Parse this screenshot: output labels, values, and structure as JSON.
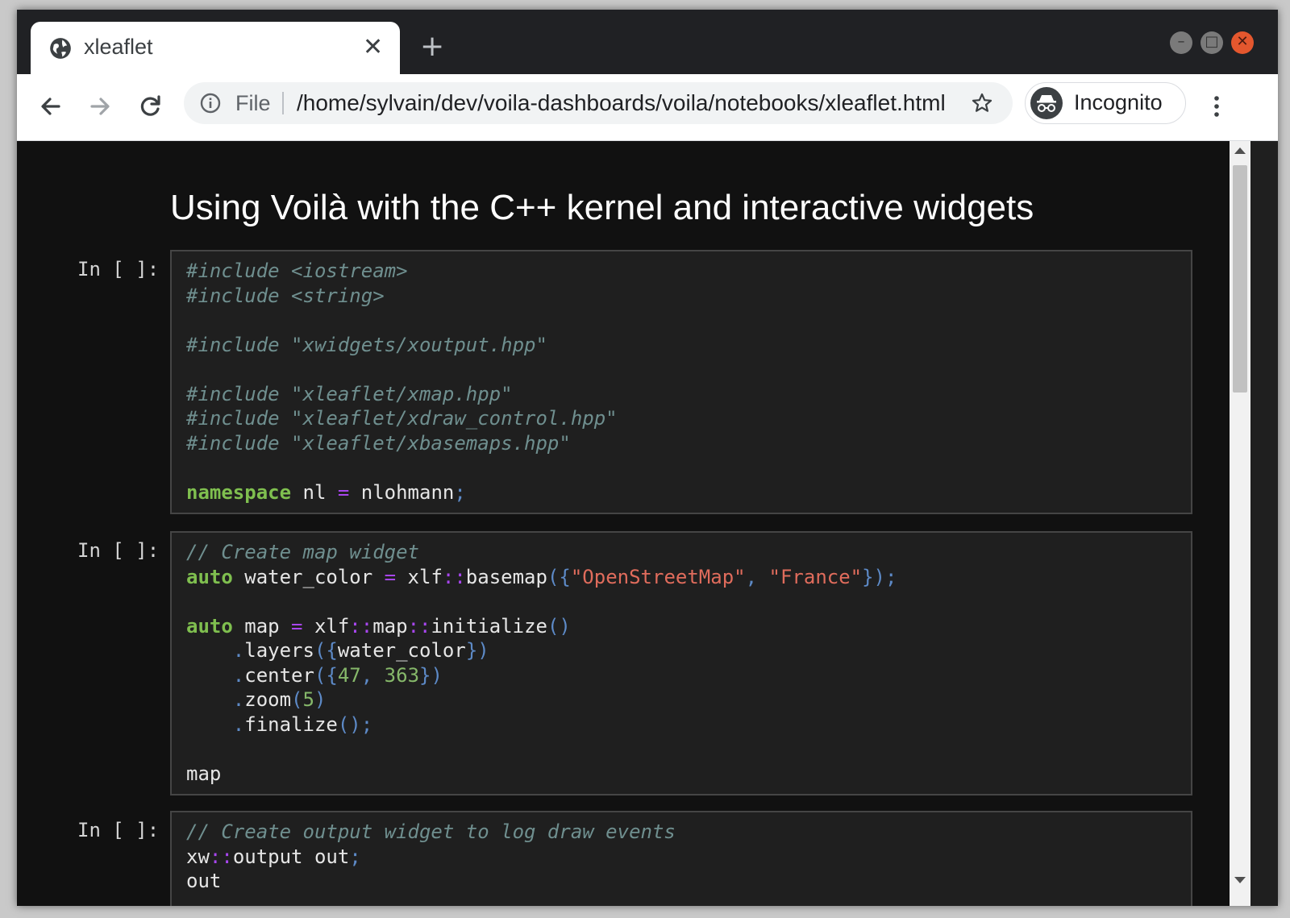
{
  "browser": {
    "tab": {
      "title": "xleaflet",
      "close_glyph": "✕",
      "icon": "globe-icon"
    },
    "new_tab_glyph": "+",
    "window_controls": {
      "minimize": "–",
      "maximize": "□",
      "close": "✕",
      "close_color": "#e4572e"
    },
    "omnibox": {
      "info_icon": "info-icon",
      "scheme_label": "File",
      "url": "/home/sylvain/dev/voila-dashboards/voila/notebooks/xleaflet.html",
      "bookmark_icon": "star-icon"
    },
    "incognito": {
      "label": "Incognito",
      "icon": "incognito-icon"
    },
    "nav": {
      "back_icon": "arrow-left-icon",
      "forward_icon": "arrow-right-icon",
      "reload_icon": "reload-icon",
      "menu_icon": "kebab-menu-icon"
    }
  },
  "page": {
    "title": "Using Voilà with the C++ kernel and interactive widgets",
    "cells": [
      {
        "prompt": "In [ ]:",
        "lines": [
          [
            [
              "cm",
              "#include <iostream>"
            ]
          ],
          [
            [
              "cm",
              "#include <string>"
            ]
          ],
          [],
          [
            [
              "cm",
              "#include \"xwidgets/xoutput.hpp\""
            ]
          ],
          [],
          [
            [
              "cm",
              "#include \"xleaflet/xmap.hpp\""
            ]
          ],
          [
            [
              "cm",
              "#include \"xleaflet/xdraw_control.hpp\""
            ]
          ],
          [
            [
              "cm",
              "#include \"xleaflet/xbasemaps.hpp\""
            ]
          ],
          [],
          [
            [
              "kw",
              "namespace"
            ],
            [
              "tx",
              " nl "
            ],
            [
              "op",
              "="
            ],
            [
              "tx",
              " nlohmann"
            ],
            [
              "pn",
              ";"
            ]
          ]
        ]
      },
      {
        "prompt": "In [ ]:",
        "lines": [
          [
            [
              "cm",
              "// Create map widget"
            ]
          ],
          [
            [
              "kw",
              "auto"
            ],
            [
              "tx",
              " water_color "
            ],
            [
              "op",
              "="
            ],
            [
              "tx",
              " xlf"
            ],
            [
              "op",
              "::"
            ],
            [
              "tx",
              "basemap"
            ],
            [
              "pn",
              "({"
            ],
            [
              "st",
              "\"OpenStreetMap\""
            ],
            [
              "pn",
              ", "
            ],
            [
              "st",
              "\"France\""
            ],
            [
              "pn",
              "});"
            ]
          ],
          [],
          [
            [
              "kw",
              "auto"
            ],
            [
              "tx",
              " map "
            ],
            [
              "op",
              "="
            ],
            [
              "tx",
              " xlf"
            ],
            [
              "op",
              "::"
            ],
            [
              "tx",
              "map"
            ],
            [
              "op",
              "::"
            ],
            [
              "tx",
              "initialize"
            ],
            [
              "pn",
              "()"
            ]
          ],
          [
            [
              "tx",
              "    "
            ],
            [
              "pn",
              "."
            ],
            [
              "tx",
              "layers"
            ],
            [
              "pn",
              "({"
            ],
            [
              "tx",
              "water_color"
            ],
            [
              "pn",
              "})"
            ]
          ],
          [
            [
              "tx",
              "    "
            ],
            [
              "pn",
              "."
            ],
            [
              "tx",
              "center"
            ],
            [
              "pn",
              "({"
            ],
            [
              "nm",
              "47"
            ],
            [
              "pn",
              ", "
            ],
            [
              "nm",
              "363"
            ],
            [
              "pn",
              "})"
            ]
          ],
          [
            [
              "tx",
              "    "
            ],
            [
              "pn",
              "."
            ],
            [
              "tx",
              "zoom"
            ],
            [
              "pn",
              "("
            ],
            [
              "nm",
              "5"
            ],
            [
              "pn",
              ")"
            ]
          ],
          [
            [
              "tx",
              "    "
            ],
            [
              "pn",
              "."
            ],
            [
              "tx",
              "finalize"
            ],
            [
              "pn",
              "();"
            ]
          ],
          [],
          [
            [
              "tx",
              "map"
            ]
          ]
        ]
      },
      {
        "prompt": "In [ ]:",
        "lines": [
          [
            [
              "cm",
              "// Create output widget to log draw events"
            ]
          ],
          [
            [
              "tx",
              "xw"
            ],
            [
              "op",
              "::"
            ],
            [
              "tx",
              "output out"
            ],
            [
              "pn",
              ";"
            ]
          ],
          [
            [
              "tx",
              "out"
            ]
          ]
        ]
      }
    ]
  }
}
